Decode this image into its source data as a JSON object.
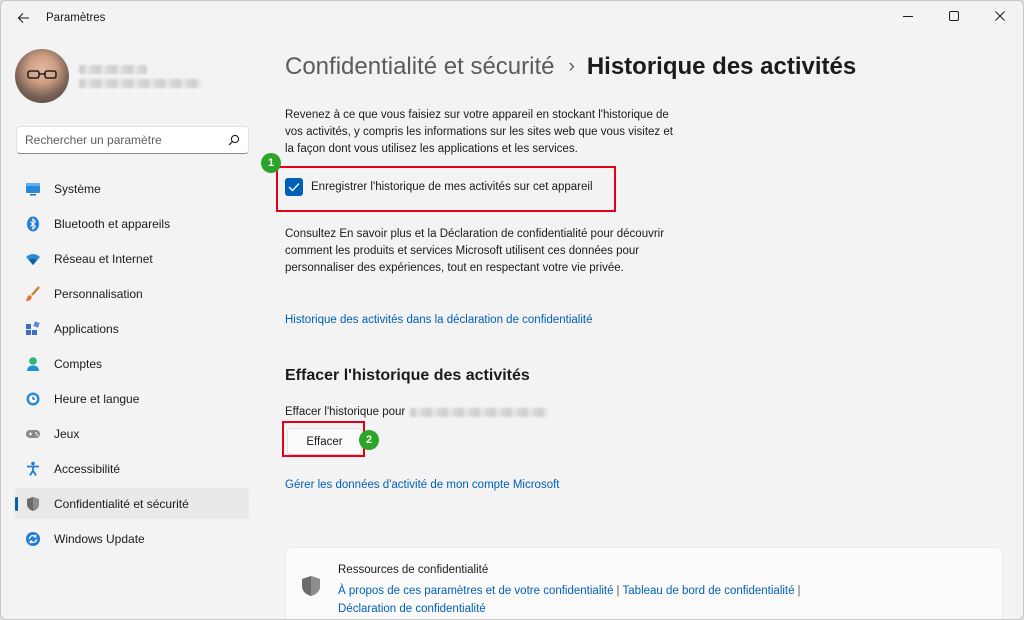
{
  "window": {
    "title": "Paramètres",
    "controls": [
      "minimize-icon",
      "maximize-icon",
      "close-icon"
    ]
  },
  "sidebar": {
    "search_placeholder": "Rechercher un paramètre",
    "items": [
      {
        "label": "Système",
        "icon": "monitor-icon"
      },
      {
        "label": "Bluetooth et appareils",
        "icon": "bluetooth-icon"
      },
      {
        "label": "Réseau et Internet",
        "icon": "wifi-icon"
      },
      {
        "label": "Personnalisation",
        "icon": "brush-icon"
      },
      {
        "label": "Applications",
        "icon": "apps-icon"
      },
      {
        "label": "Comptes",
        "icon": "person-icon"
      },
      {
        "label": "Heure et langue",
        "icon": "globe-clock-icon"
      },
      {
        "label": "Jeux",
        "icon": "gamepad-icon"
      },
      {
        "label": "Accessibilité",
        "icon": "accessibility-icon"
      },
      {
        "label": "Confidentialité et sécurité",
        "icon": "shield-icon",
        "active": true
      },
      {
        "label": "Windows Update",
        "icon": "update-icon"
      }
    ]
  },
  "main": {
    "breadcrumb_parent": "Confidentialité et sécurité",
    "breadcrumb_sep": "›",
    "page_title": "Historique des activités",
    "description": "Revenez à ce que vous faisiez sur votre appareil en stockant l'historique de vos activités, y compris les informations sur les sites web que vous visitez et la façon dont vous utilisez les applications et les services.",
    "checkbox_label": "Enregistrer l'historique de mes activités sur cet appareil",
    "checkbox_checked": true,
    "description2": "Consultez En savoir plus et la Déclaration de confidentialité pour découvrir comment les produits et services Microsoft utilisent ces données pour personnaliser des expériences, tout en respectant votre vie privée.",
    "privacy_link": "Historique des activités dans la déclaration de confidentialité",
    "clear_section_title": "Effacer l'historique des activités",
    "clear_for_label": "Effacer l'historique pour",
    "clear_button": "Effacer",
    "manage_link": "Gérer les données d'activité de mon compte Microsoft",
    "resources_title": "Ressources de confidentialité",
    "resource_links": [
      "À propos de ces paramètres et de votre confidentialité",
      "Tableau de bord de confidentialité",
      "Déclaration de confidentialité"
    ],
    "resource_sep": "|"
  },
  "annotations": {
    "badge1": "1",
    "badge2": "2",
    "highlight_color": "#e3001b",
    "badge_color": "#2aa52a"
  },
  "colors": {
    "accent": "#005fb8",
    "background": "#f3f3f3"
  }
}
